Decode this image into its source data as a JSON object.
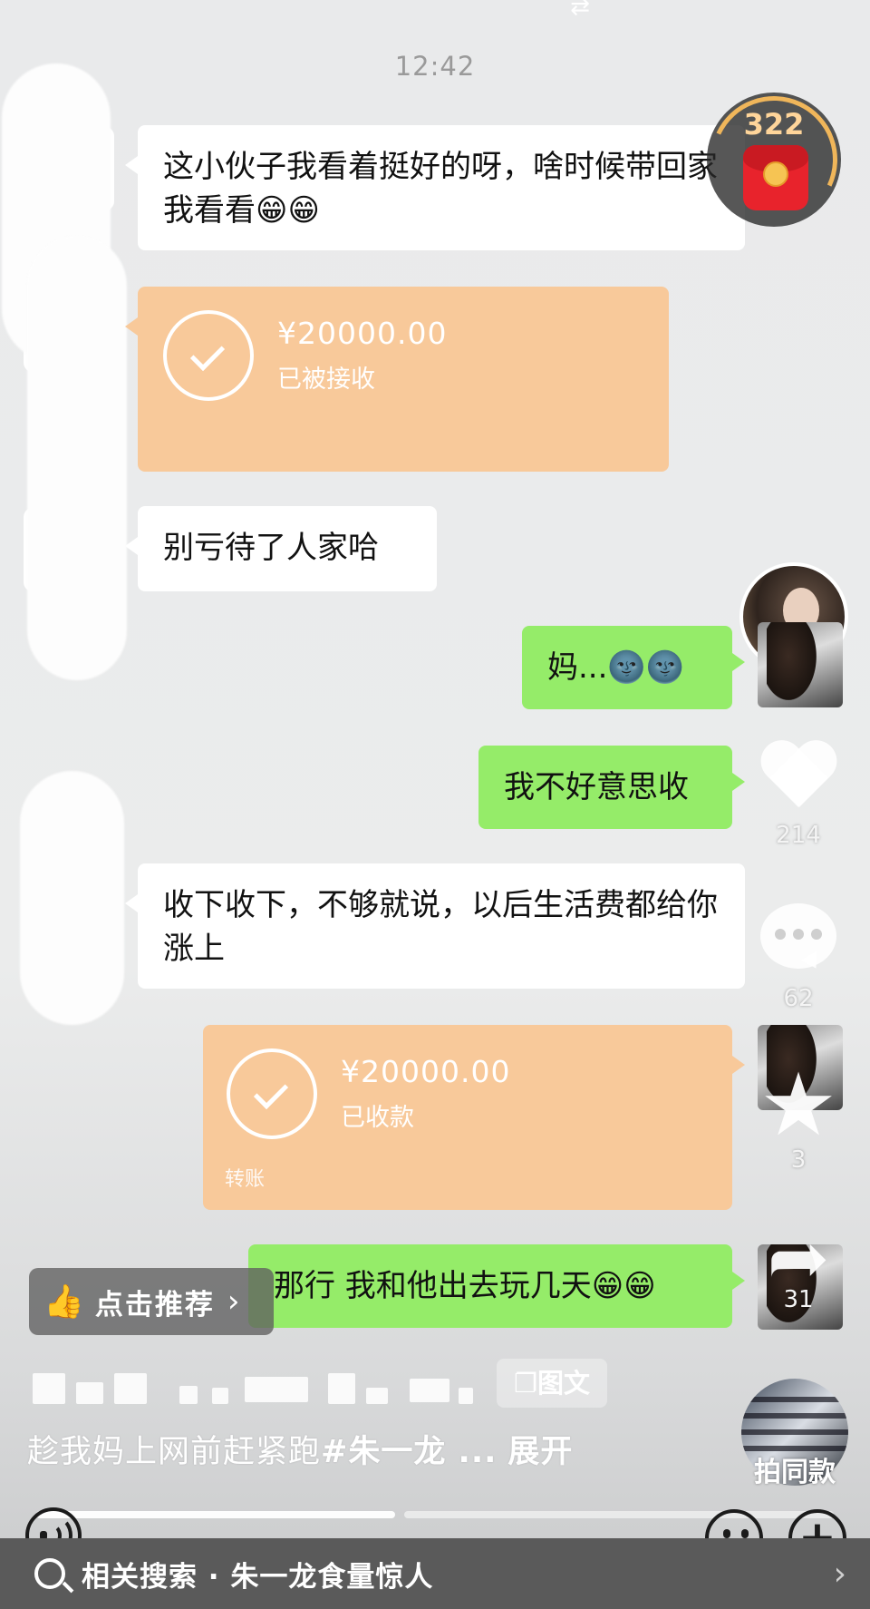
{
  "status": {
    "timestamp": "12:42"
  },
  "chat": {
    "msg1": "这小伙子我看着挺好的呀，啥时候带回家我看看😁😁",
    "transfer1": {
      "amount": "¥20000.00",
      "status": "已被接收"
    },
    "msg2": "别亏待了人家哈",
    "reply1": "妈...🌚🌚",
    "reply2": "我不好意思收",
    "msg3": "收下收下，不够就说，以后生活费都给你涨上",
    "transfer2": {
      "amount": "¥20000.00",
      "status": "已收款",
      "label": "转账"
    },
    "reply3": "那行 我和他出去玩几天😁😁"
  },
  "redpack": {
    "count": "322"
  },
  "rail": {
    "likes": "214",
    "comments": "62",
    "favorites": "3",
    "shares": "31"
  },
  "recommend": {
    "label": "点击推荐"
  },
  "post": {
    "badge": "图文",
    "caption": "趁我妈上网前赶紧跑",
    "tag": "#朱一龙 ...",
    "expand": "展开"
  },
  "same_style": {
    "label": "拍同款"
  },
  "progress": {
    "filled_fraction": 0.45
  },
  "search": {
    "text": "相关搜索 · 朱一龙食量惊人"
  },
  "colors": {
    "incoming_bubble": "#ffffff",
    "outgoing_bubble": "#95ec69",
    "transfer_card": "#f8c99a",
    "follow_plus": "#fe2c55",
    "redpack": "#e8232c"
  }
}
